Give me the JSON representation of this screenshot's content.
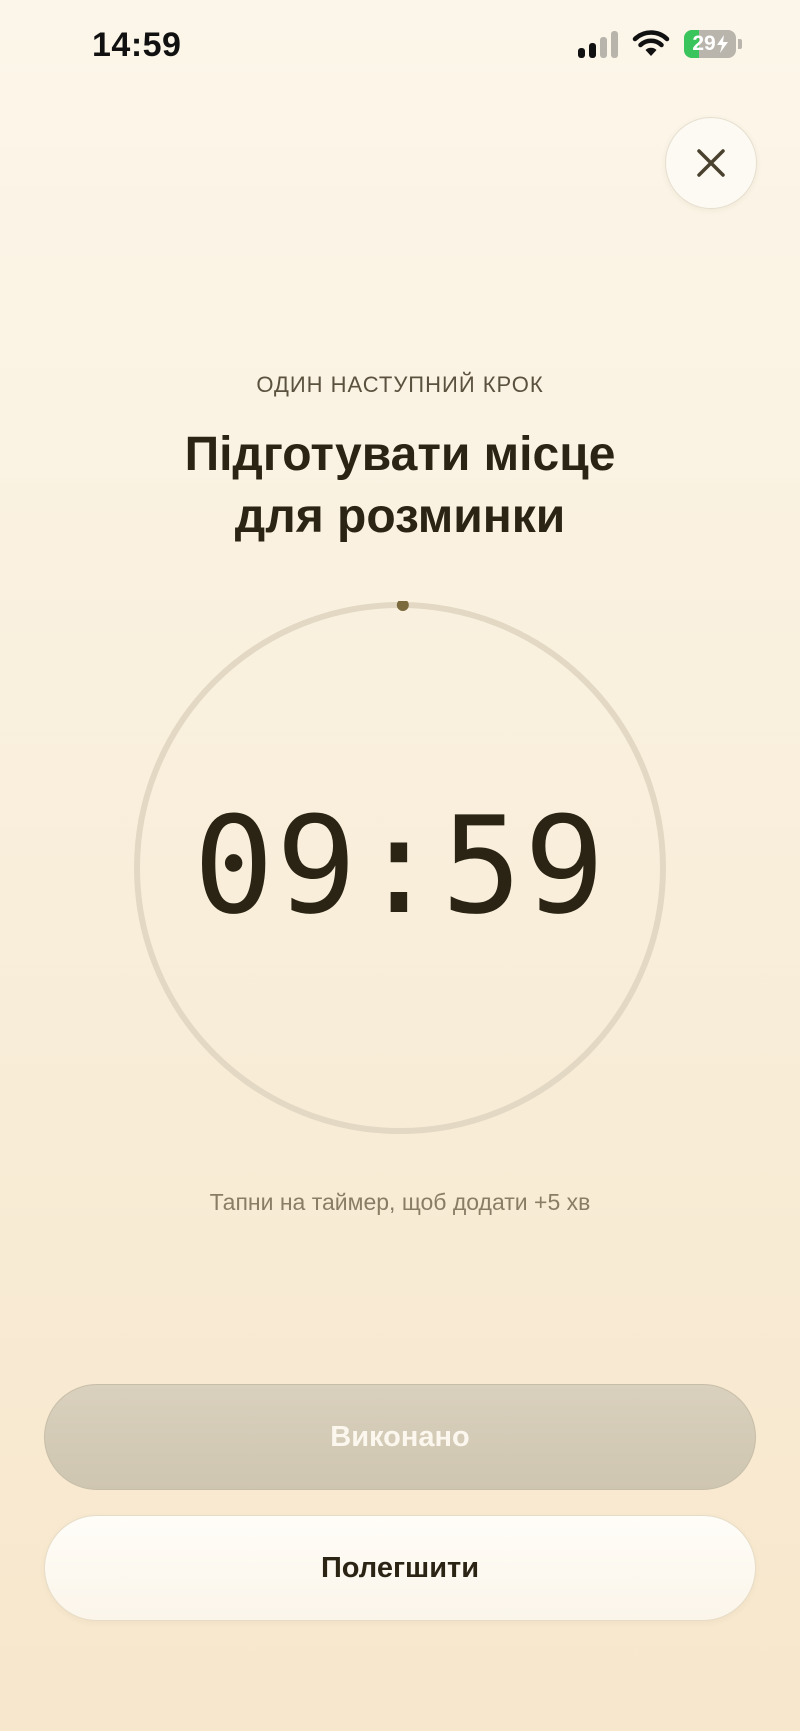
{
  "status_bar": {
    "time": "14:59",
    "battery_level": "29",
    "battery_percent": 29,
    "icons": [
      "cellular-signal-icon",
      "wifi-icon",
      "battery-charging-icon"
    ]
  },
  "header": {
    "close_icon": "close-icon"
  },
  "step": {
    "eyebrow": "ОДИН НАСТУПНИЙ КРОК",
    "title_line1": "Підготувати місце",
    "title_line2": "для розминки"
  },
  "timer": {
    "value": "09:59",
    "progress": 0.0017,
    "hint": "Тапни на таймер, щоб додати +5 хв"
  },
  "actions": {
    "done_label": "Виконано",
    "ease_label": "Полегшити"
  },
  "colors": {
    "background": "#f9efdc",
    "ring": "#e2d8c3",
    "progress_dot": "#7a6a3e",
    "done_button": "#d3cab6",
    "battery_green": "#3ac45c"
  }
}
